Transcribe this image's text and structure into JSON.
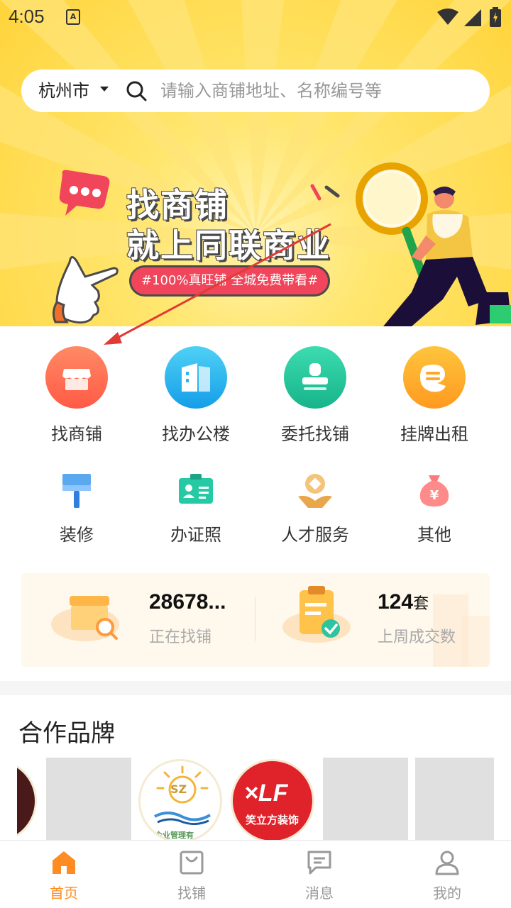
{
  "status_bar": {
    "time": "4:05",
    "notification_glyph": "A"
  },
  "search": {
    "city": "杭州市",
    "placeholder": "请输入商铺地址、名称编号等"
  },
  "banner": {
    "title_line1": "找商铺",
    "title_line2": "就上同联商业",
    "tag": "#100%真旺铺 全城免费带看#"
  },
  "services_primary": [
    {
      "label": "找商铺",
      "icon": "storefront-icon",
      "color": "#ff6b4a"
    },
    {
      "label": "找办公楼",
      "icon": "office-building-icon",
      "color": "#29b6f6"
    },
    {
      "label": "委托找铺",
      "icon": "stamp-icon",
      "color": "#26c6a0"
    },
    {
      "label": "挂牌出租",
      "icon": "rent-sign-icon",
      "color": "#ffa726"
    }
  ],
  "services_secondary": [
    {
      "label": "装修",
      "icon": "paint-roller-icon"
    },
    {
      "label": "办证照",
      "icon": "id-card-icon"
    },
    {
      "label": "人才服务",
      "icon": "talent-icon"
    },
    {
      "label": "其他",
      "icon": "money-bag-icon"
    }
  ],
  "stats": {
    "searching_value": "28678...",
    "searching_label": "正在找铺",
    "deals_value": "124",
    "deals_unit": "套",
    "deals_label": "上周成交数"
  },
  "brands": {
    "title": "合作品牌",
    "logo_sz_text": "SZ",
    "logo_sz_caption": "企业管理有",
    "logo_xlf_mark": "×LF",
    "logo_xlf_text": "笑立方装饰"
  },
  "bottom_nav": [
    {
      "label": "首页",
      "icon": "home-icon",
      "active": true
    },
    {
      "label": "找铺",
      "icon": "shopping-bag-icon",
      "active": false
    },
    {
      "label": "消息",
      "icon": "message-icon",
      "active": false
    },
    {
      "label": "我的",
      "icon": "profile-icon",
      "active": false
    }
  ],
  "colors": {
    "accent": "#ff8c22",
    "banner_yellow": "#ffd43b",
    "tag_red": "#f0455a",
    "annotation_arrow": "#e03b35"
  }
}
